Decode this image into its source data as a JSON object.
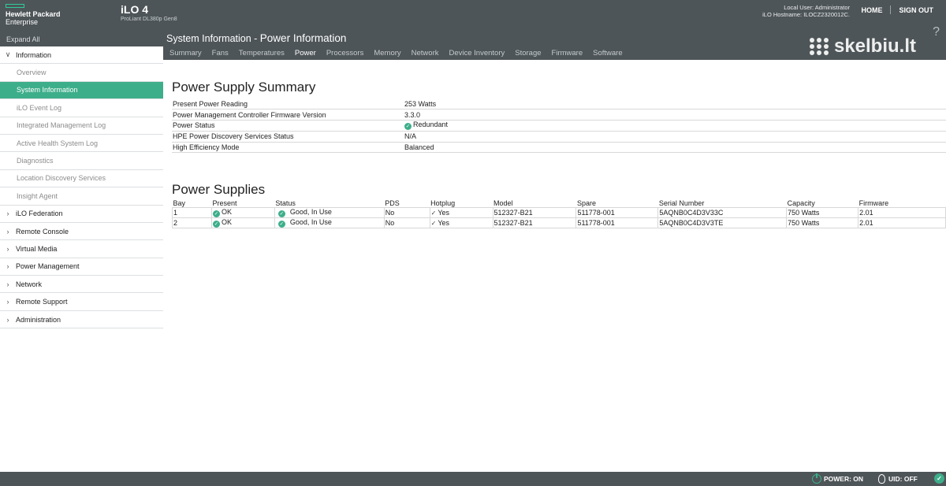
{
  "header": {
    "brand_line1": "Hewlett Packard",
    "brand_line2": "Enterprise",
    "product_title": "iLO 4",
    "product_subtitle": "ProLiant DL380p Gen8",
    "local_user": "Local User: Administrator",
    "hostname": "iLO Hostname: ILOCZ2320012C.",
    "home_label": "HOME",
    "signout_label": "SIGN OUT",
    "help_label": "?"
  },
  "watermark": "skelbiu.lt",
  "sidebar": {
    "expand_all": "Expand All",
    "items": [
      {
        "label": "Information",
        "chev": "∨",
        "type": "section"
      },
      {
        "label": "Overview",
        "type": "sub"
      },
      {
        "label": "System Information",
        "type": "sub",
        "active": true
      },
      {
        "label": "iLO Event Log",
        "type": "sub"
      },
      {
        "label": "Integrated Management Log",
        "type": "sub"
      },
      {
        "label": "Active Health System Log",
        "type": "sub"
      },
      {
        "label": "Diagnostics",
        "type": "sub"
      },
      {
        "label": "Location Discovery Services",
        "type": "sub"
      },
      {
        "label": "Insight Agent",
        "type": "sub"
      },
      {
        "label": "iLO Federation",
        "chev": "›",
        "type": "section"
      },
      {
        "label": "Remote Console",
        "chev": "›",
        "type": "section"
      },
      {
        "label": "Virtual Media",
        "chev": "›",
        "type": "section"
      },
      {
        "label": "Power Management",
        "chev": "›",
        "type": "section"
      },
      {
        "label": "Network",
        "chev": "›",
        "type": "section"
      },
      {
        "label": "Remote Support",
        "chev": "›",
        "type": "section"
      },
      {
        "label": "Administration",
        "chev": "›",
        "type": "section"
      }
    ]
  },
  "main": {
    "title_prefix": "System Information - ",
    "title_section": "Power Information",
    "tabs": [
      "Summary",
      "Fans",
      "Temperatures",
      "Power",
      "Processors",
      "Memory",
      "Network",
      "Device Inventory",
      "Storage",
      "Firmware",
      "Software"
    ],
    "active_tab": "Power"
  },
  "summary": {
    "heading": "Power Supply Summary",
    "rows": [
      {
        "label": "Present Power Reading",
        "value": "253 Watts"
      },
      {
        "label": "Power Management Controller Firmware Version",
        "value": "3.3.0"
      },
      {
        "label": "Power Status",
        "value": "Redundant",
        "icon": "ok-icon"
      },
      {
        "label": "HPE Power Discovery Services Status",
        "value": "N/A"
      },
      {
        "label": "High Efficiency Mode",
        "value": "Balanced"
      }
    ]
  },
  "supplies": {
    "heading": "Power Supplies",
    "columns": [
      "Bay",
      "Present",
      "Status",
      "PDS",
      "Hotplug",
      "Model",
      "Spare",
      "Serial Number",
      "Capacity",
      "Firmware"
    ],
    "rows": [
      {
        "bay": "1",
        "present": "OK",
        "status": "Good, In Use",
        "pds": "No",
        "hotplug": "Yes",
        "model": "512327-B21",
        "spare": "511778-001",
        "serial": "5AQNB0C4D3V33C",
        "capacity": "750 Watts",
        "firmware": "2.01"
      },
      {
        "bay": "2",
        "present": "OK",
        "status": "Good, In Use",
        "pds": "No",
        "hotplug": "Yes",
        "model": "512327-B21",
        "spare": "511778-001",
        "serial": "5AQNB0C4D3V3TE",
        "capacity": "750 Watts",
        "firmware": "2.01"
      }
    ]
  },
  "footer": {
    "power": "POWER: ON",
    "uid": "UID: OFF"
  },
  "colors": {
    "accent": "#3dae8a",
    "chrome": "#4e5558"
  }
}
